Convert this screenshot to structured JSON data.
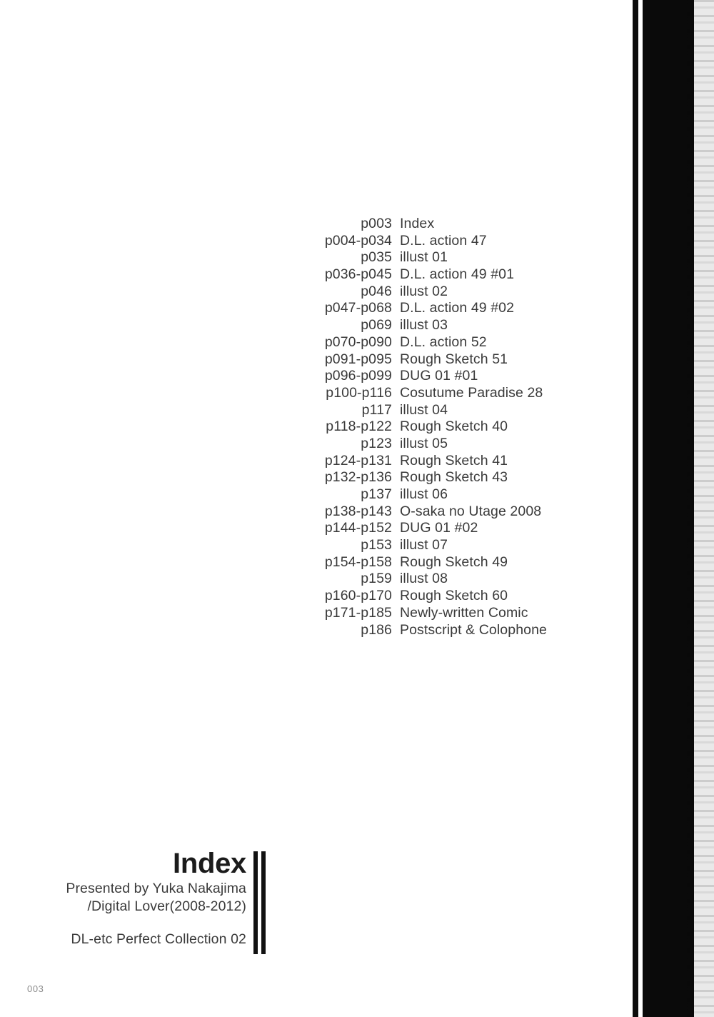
{
  "page": {
    "folio": "003",
    "background_color": "#ffffff",
    "text_color": "#3a3a3a"
  },
  "index": {
    "rows": [
      {
        "pages": "p003",
        "title": "Index"
      },
      {
        "pages": "p004-p034",
        "title": "D.L. action 47"
      },
      {
        "pages": "p035",
        "title": "illust 01"
      },
      {
        "pages": "p036-p045",
        "title": "D.L. action 49 #01"
      },
      {
        "pages": "p046",
        "title": "illust 02"
      },
      {
        "pages": "p047-p068",
        "title": "D.L. action 49 #02"
      },
      {
        "pages": "p069",
        "title": "illust 03"
      },
      {
        "pages": "p070-p090",
        "title": "D.L. action 52"
      },
      {
        "pages": "p091-p095",
        "title": "Rough Sketch 51"
      },
      {
        "pages": "p096-p099",
        "title": "DUG 01 #01"
      },
      {
        "pages": "p100-p116",
        "title": "Cosutume Paradise 28"
      },
      {
        "pages": "p117",
        "title": "illust 04"
      },
      {
        "pages": "p118-p122",
        "title": "Rough Sketch 40"
      },
      {
        "pages": "p123",
        "title": "illust 05"
      },
      {
        "pages": "p124-p131",
        "title": "Rough Sketch 41"
      },
      {
        "pages": "p132-p136",
        "title": "Rough Sketch 43"
      },
      {
        "pages": "p137",
        "title": "illust 06"
      },
      {
        "pages": "p138-p143",
        "title": "O-saka no Utage 2008"
      },
      {
        "pages": "p144-p152",
        "title": "DUG 01 #02"
      },
      {
        "pages": "p153",
        "title": "illust 07"
      },
      {
        "pages": "p154-p158",
        "title": "Rough Sketch 49"
      },
      {
        "pages": "p159",
        "title": "illust 08"
      },
      {
        "pages": "p160-p170",
        "title": "Rough Sketch 60"
      },
      {
        "pages": "p171-p185",
        "title": "Newly-written Comic"
      },
      {
        "pages": "p186",
        "title": "Postscript & Colophone"
      }
    ]
  },
  "title_block": {
    "title": "Index",
    "credit_line_1": "Presented by Yuka Nakajima",
    "credit_line_2": "/Digital Lover(2008-2012)",
    "collection": "DL-etc Perfect Collection 02"
  }
}
